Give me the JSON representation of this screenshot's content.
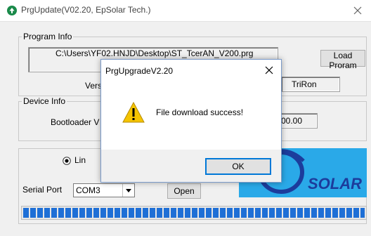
{
  "window": {
    "title": "PrgUpdate(V02.20, EpSolar Tech.)"
  },
  "program_info": {
    "legend": "Program Info",
    "path": "C:\\Users\\YF02.HNJD\\Desktop\\ST_TcerAN_V200.prg",
    "version_label": "Vers",
    "load_button": "Load Proram",
    "model": "TriRon"
  },
  "device_info": {
    "legend": "Device Info",
    "bootloader_label": "Bootloader V",
    "value_fragment": "00.00"
  },
  "connection": {
    "radio_label": "Lin",
    "serial_port_label": "Serial Port",
    "serial_port_value": "COM3",
    "open_button": "Open"
  },
  "logo": {
    "text": "SOLAR"
  },
  "progress": {
    "percent": 100
  },
  "dialog": {
    "title": "PrgUpgradeV2.20",
    "message": "File download success!",
    "ok_button": "OK"
  },
  "colors": {
    "accent": "#0078d7",
    "progress": "#1e6fd6",
    "logo_bg": "#2aa9e8",
    "warning": "#f5c400"
  }
}
